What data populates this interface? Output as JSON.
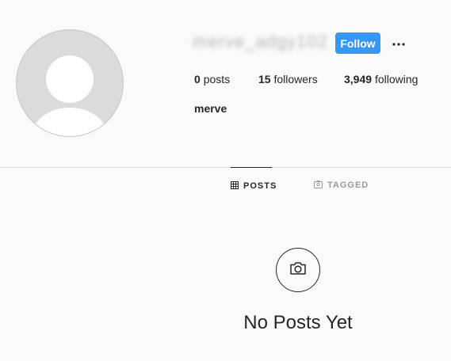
{
  "profile": {
    "username": "merve_adgy102",
    "full_name": "merve",
    "follow_label": "Follow",
    "stats": {
      "posts_count": "0",
      "posts_label": "posts",
      "followers_count": "15",
      "followers_label": "followers",
      "following_count": "3,949",
      "following_label": "following"
    }
  },
  "tabs": {
    "posts": "POSTS",
    "tagged": "TAGGED"
  },
  "empty_state": {
    "title": "No Posts Yet"
  },
  "colors": {
    "accent": "#3897f0",
    "background": "#fafafa",
    "text": "#262626",
    "muted": "#999999"
  },
  "icons": {
    "more": "more-horizontal-icon",
    "grid": "grid-icon",
    "tagged": "tag-icon",
    "camera": "camera-icon"
  }
}
